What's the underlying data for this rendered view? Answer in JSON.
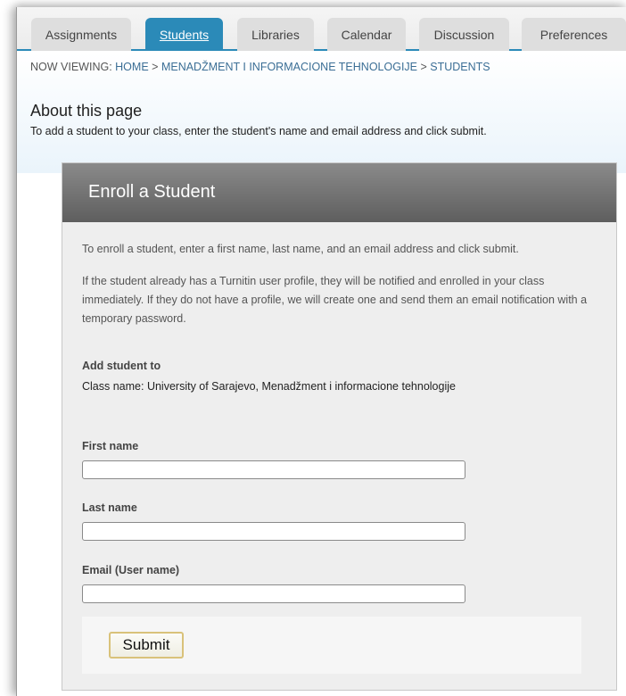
{
  "tabs": [
    {
      "label": "Assignments",
      "active": false
    },
    {
      "label": "Students",
      "active": true
    },
    {
      "label": "Libraries",
      "active": false
    },
    {
      "label": "Calendar",
      "active": false
    },
    {
      "label": "Discussion",
      "active": false
    },
    {
      "label": "Preferences",
      "active": false
    }
  ],
  "breadcrumb": {
    "prefix": "NOW VIEWING:",
    "items": [
      "HOME",
      "MENADŽMENT I INFORMACIONE TEHNOLOGIJE",
      "STUDENTS"
    ],
    "separator": ">"
  },
  "about": {
    "title": "About this page",
    "text": "To add a student to your class, enter the student's name and email address and click submit."
  },
  "enroll": {
    "title": "Enroll a Student",
    "instruction_1": "To enroll a student, enter a first name, last name, and an email address and click submit.",
    "instruction_2": "If the student already has a Turnitin user profile, they will be notified and enrolled in your class immediately. If they do not have a profile, we will create one and send them an email notification with a temporary password.",
    "add_to_label": "Add student to",
    "class_name": "Class name: University of Sarajevo, Menadžment i informacione tehnologije",
    "first_name_label": "First name",
    "first_name_value": "",
    "last_name_label": "Last name",
    "last_name_value": "",
    "email_label": "Email (User name)",
    "email_value": "",
    "submit_label": "Submit"
  },
  "colors": {
    "accent": "#2b8ab8",
    "header_gradient_top": "#8a8a8a",
    "header_gradient_bottom": "#5e5e5e",
    "submit_border": "#d9c27a"
  }
}
